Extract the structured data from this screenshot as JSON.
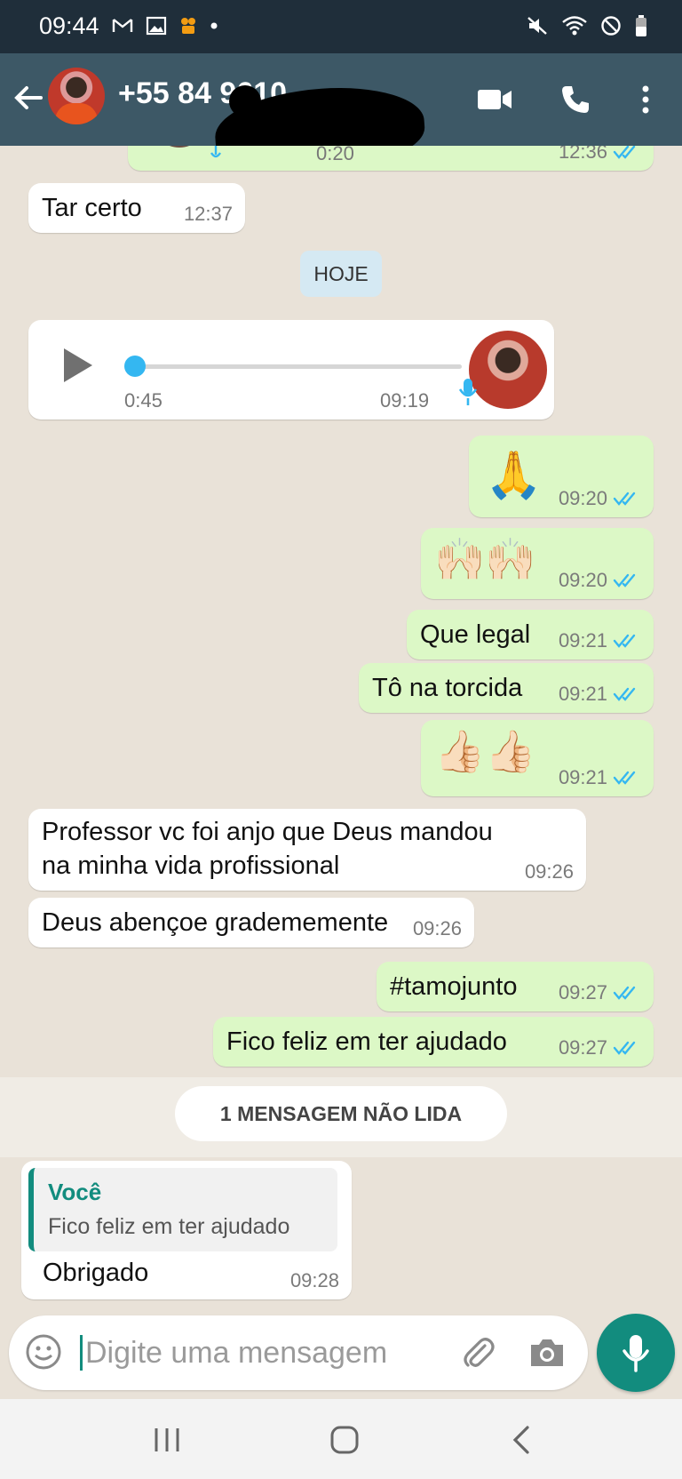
{
  "status_bar": {
    "time": "09:44"
  },
  "header": {
    "contact_name": "+55 84 9610"
  },
  "colors": {
    "header_bg": "#3d5866",
    "status_bg": "#1f2e3a",
    "outgoing_bubble": "#dcf8c6",
    "accent": "#128c7e",
    "tick_blue": "#34b7f1"
  },
  "chat": {
    "top_partial_time": "12:36",
    "top_partial_duration": "0:20",
    "day_label": "HOJE",
    "voice_note": {
      "duration": "0:45",
      "time": "09:19"
    },
    "messages": [
      {
        "dir": "in",
        "text": "Tar certo",
        "time": "12:37"
      },
      {
        "dir": "out",
        "text": "🙏",
        "time": "09:20"
      },
      {
        "dir": "out",
        "text": "🙌🏻🙌🏻",
        "time": "09:20"
      },
      {
        "dir": "out",
        "text": "Que legal",
        "time": "09:21"
      },
      {
        "dir": "out",
        "text": "Tô na torcida",
        "time": "09:21"
      },
      {
        "dir": "out",
        "text": "👍🏻👍🏻",
        "time": "09:21"
      },
      {
        "dir": "in",
        "text_line1": "Professor vc foi anjo que Deus mandou",
        "text_line2": "na minha vida profissional",
        "time": "09:26"
      },
      {
        "dir": "in",
        "text": "Deus abençoe gradememente",
        "time": "09:26"
      },
      {
        "dir": "out",
        "text": "#tamojunto",
        "time": "09:27"
      },
      {
        "dir": "out",
        "text": "Fico feliz em ter ajudado",
        "time": "09:27"
      }
    ],
    "unread_label": "1 MENSAGEM NÃO LIDA",
    "last_message": {
      "reply_author": "Você",
      "reply_text": "Fico feliz em ter ajudado",
      "text": "Obrigado",
      "time": "09:28"
    }
  },
  "composer": {
    "placeholder": "Digite uma mensagem"
  }
}
